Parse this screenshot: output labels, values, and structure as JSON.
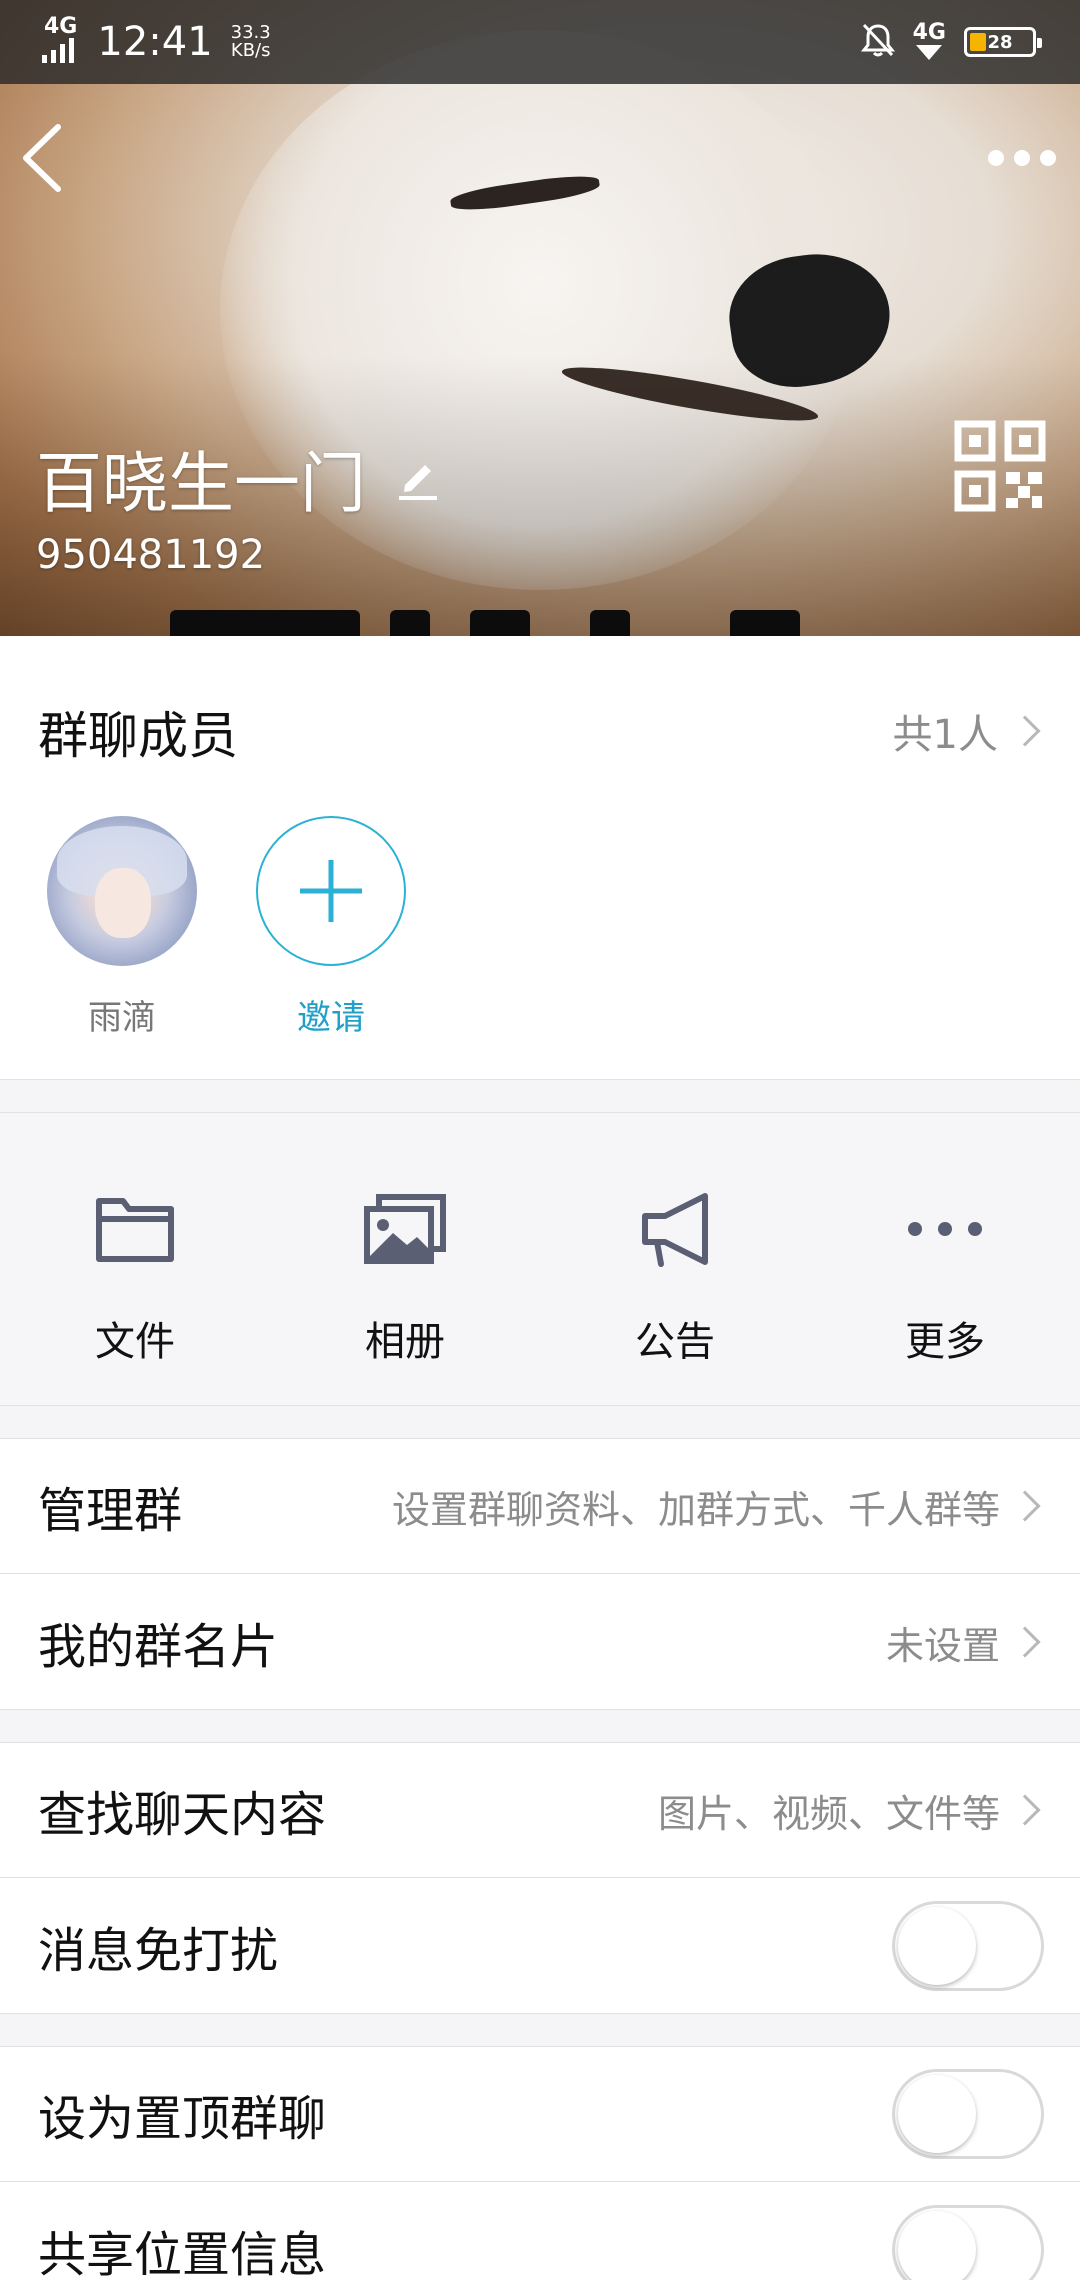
{
  "status_bar": {
    "network": "4G",
    "time": "12:41",
    "speed_value": "33.3",
    "speed_unit": "KB/s",
    "network_right": "4G",
    "battery_level": "28"
  },
  "header": {
    "group_name": "百晓生一门",
    "group_id": "950481192"
  },
  "members": {
    "title": "群聊成员",
    "count": "共1人",
    "list": [
      {
        "name": "雨滴"
      }
    ],
    "invite_label": "邀请"
  },
  "tools": [
    {
      "label": "文件",
      "icon": "folder-icon"
    },
    {
      "label": "相册",
      "icon": "album-icon"
    },
    {
      "label": "公告",
      "icon": "megaphone-icon"
    },
    {
      "label": "更多",
      "icon": "more-dots-icon"
    }
  ],
  "settings": {
    "manage_group": {
      "title": "管理群",
      "value": "设置群聊资料、加群方式、千人群等"
    },
    "my_card": {
      "title": "我的群名片",
      "value": "未设置"
    },
    "search_chat": {
      "title": "查找聊天内容",
      "value": "图片、视频、文件等"
    },
    "do_not_disturb": {
      "title": "消息免打扰",
      "on": false
    },
    "pin_chat": {
      "title": "设为置顶群聊",
      "on": false
    },
    "share_location": {
      "title": "共享位置信息",
      "on": false
    }
  },
  "colors": {
    "accent": "#2bb1d6",
    "battery": "#f5b400",
    "text_secondary": "#8c8c8c",
    "icon_gray": "#5a5f73"
  }
}
